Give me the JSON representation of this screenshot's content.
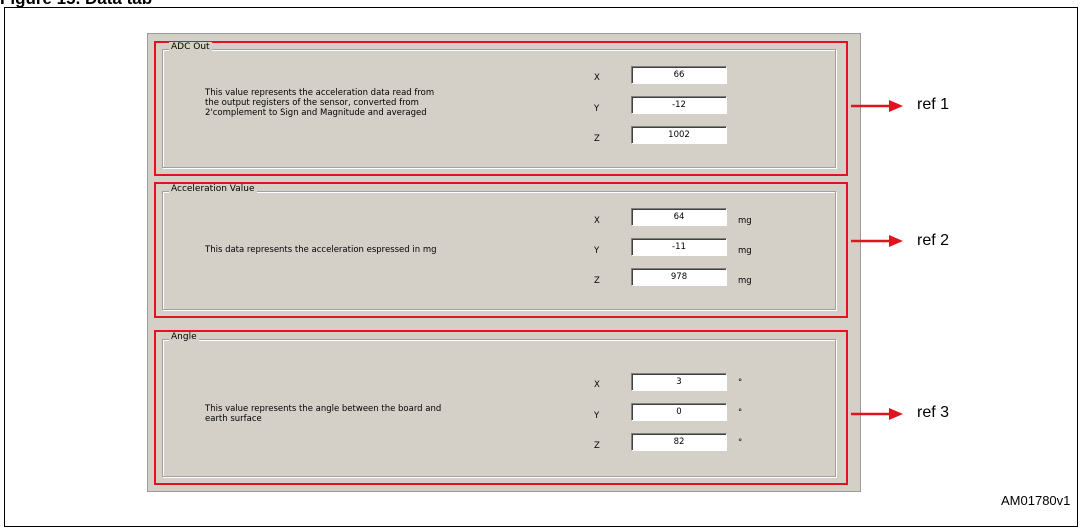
{
  "figure": {
    "caption": "Figure 15. Data tab",
    "code": "AM01780v1"
  },
  "groups": [
    {
      "title": "ADC Out",
      "description": "This value represents the acceleration data read from\nthe output registers of the sensor, converted from\n2'complement to Sign and Magnitude and averaged",
      "axes": [
        {
          "label": "X",
          "value": "66",
          "unit": ""
        },
        {
          "label": "Y",
          "value": "-12",
          "unit": ""
        },
        {
          "label": "Z",
          "value": "1002",
          "unit": ""
        }
      ],
      "ref": "ref 1"
    },
    {
      "title": "Acceleration Value",
      "description": "This data represents the acceleration espressed in mg",
      "axes": [
        {
          "label": "X",
          "value": "64",
          "unit": "mg"
        },
        {
          "label": "Y",
          "value": "-11",
          "unit": "mg"
        },
        {
          "label": "Z",
          "value": "978",
          "unit": "mg"
        }
      ],
      "ref": "ref 2"
    },
    {
      "title": "Angle",
      "description": "This value represents the angle between the board and\nearth surface",
      "axes": [
        {
          "label": "X",
          "value": "3",
          "unit": "°"
        },
        {
          "label": "Y",
          "value": "0",
          "unit": "°"
        },
        {
          "label": "Z",
          "value": "82",
          "unit": "°"
        }
      ],
      "ref": "ref 3"
    }
  ]
}
